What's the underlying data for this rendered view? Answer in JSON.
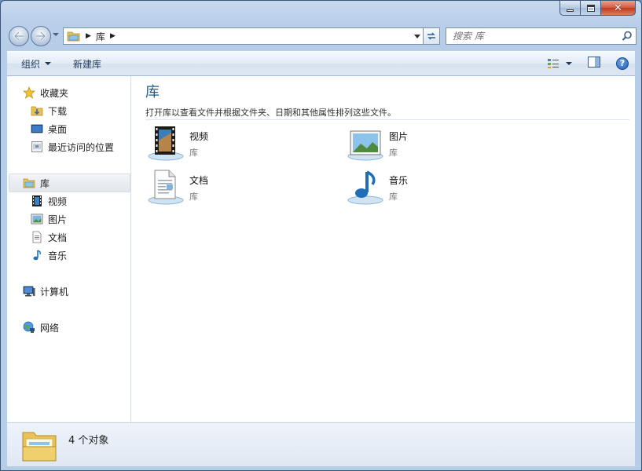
{
  "window": {
    "caption_close": "✕"
  },
  "address": {
    "path": [
      "库"
    ],
    "search_placeholder": "搜索 库"
  },
  "command_bar": {
    "organize_label": "组织",
    "new_library_label": "新建库"
  },
  "nav": {
    "favorites": {
      "label": "收藏夹",
      "items": [
        {
          "label": "下载",
          "icon": "download-folder-icon"
        },
        {
          "label": "桌面",
          "icon": "desktop-icon"
        },
        {
          "label": "最近访问的位置",
          "icon": "recent-places-icon"
        }
      ]
    },
    "libraries": {
      "label": "库",
      "items": [
        {
          "label": "视频",
          "icon": "video-library-icon"
        },
        {
          "label": "图片",
          "icon": "pictures-library-icon"
        },
        {
          "label": "文档",
          "icon": "documents-library-icon"
        },
        {
          "label": "音乐",
          "icon": "music-library-icon"
        }
      ]
    },
    "computer": {
      "label": "计算机"
    },
    "network": {
      "label": "网络"
    }
  },
  "main": {
    "title": "库",
    "description": "打开库以查看文件并根据文件夹、日期和其他属性排列这些文件。",
    "libraries": [
      {
        "name": "视频",
        "type": "库",
        "icon": "video-library-icon"
      },
      {
        "name": "图片",
        "type": "库",
        "icon": "pictures-library-icon"
      },
      {
        "name": "文档",
        "type": "库",
        "icon": "documents-library-icon"
      },
      {
        "name": "音乐",
        "type": "库",
        "icon": "music-library-icon"
      }
    ]
  },
  "details": {
    "item_count": "4 个对象"
  },
  "colors": {
    "title_accent": "#1e5c8c",
    "frame": "#b9cfe9"
  }
}
